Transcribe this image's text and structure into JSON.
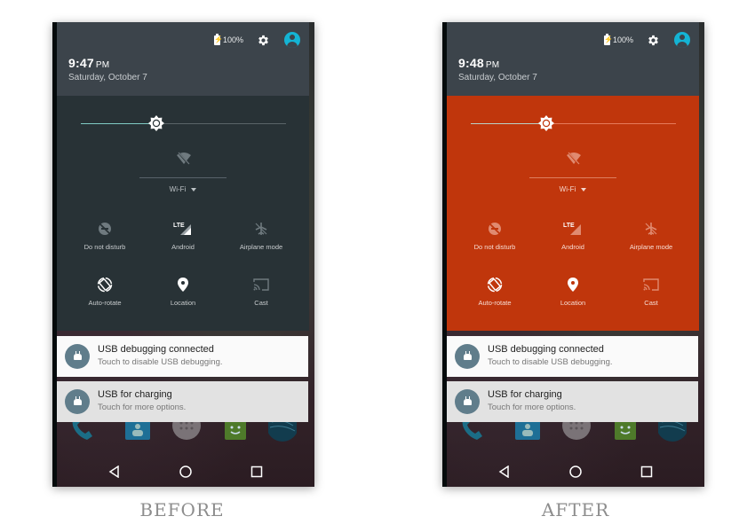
{
  "panels": [
    {
      "id": "before",
      "status": {
        "battery_text": "100%"
      },
      "clock": {
        "time": "9:47",
        "ampm": "PM"
      },
      "date": "Saturday, October 7",
      "brightness": 0.37,
      "wifi_label": "Wi-Fi",
      "tiles": [
        {
          "label": "Do not disturb",
          "icon": "do-not-disturb-icon",
          "active": false
        },
        {
          "label": "Android",
          "icon": "lte-signal-icon",
          "active": true
        },
        {
          "label": "Airplane mode",
          "icon": "airplane-icon",
          "active": false
        },
        {
          "label": "Auto-rotate",
          "icon": "auto-rotate-icon",
          "active": true
        },
        {
          "label": "Location",
          "icon": "location-pin-icon",
          "active": true
        },
        {
          "label": "Cast",
          "icon": "cast-icon",
          "active": false
        }
      ],
      "quick_settings_bg": "#283236"
    },
    {
      "id": "after",
      "status": {
        "battery_text": "100%"
      },
      "clock": {
        "time": "9:48",
        "ampm": "PM"
      },
      "date": "Saturday, October 7",
      "brightness": 0.37,
      "wifi_label": "Wi-Fi",
      "tiles": [
        {
          "label": "Do not disturb",
          "icon": "do-not-disturb-icon",
          "active": false
        },
        {
          "label": "Android",
          "icon": "lte-signal-icon",
          "active": true
        },
        {
          "label": "Airplane mode",
          "icon": "airplane-icon",
          "active": false
        },
        {
          "label": "Auto-rotate",
          "icon": "auto-rotate-icon",
          "active": true
        },
        {
          "label": "Location",
          "icon": "location-pin-icon",
          "active": true
        },
        {
          "label": "Cast",
          "icon": "cast-icon",
          "active": false
        }
      ],
      "quick_settings_bg": "#c0360c"
    }
  ],
  "notifications": [
    {
      "title": "USB debugging connected",
      "subtitle": "Touch to disable USB debugging."
    },
    {
      "title": "USB for charging",
      "subtitle": "Touch for more options."
    }
  ],
  "captions": {
    "before": "BEFORE",
    "after": "AFTER"
  },
  "colors": {
    "accent_avatar": "#14b4d4",
    "header_bg": "#3c444b",
    "notif_icon_bg": "#607d8b"
  }
}
